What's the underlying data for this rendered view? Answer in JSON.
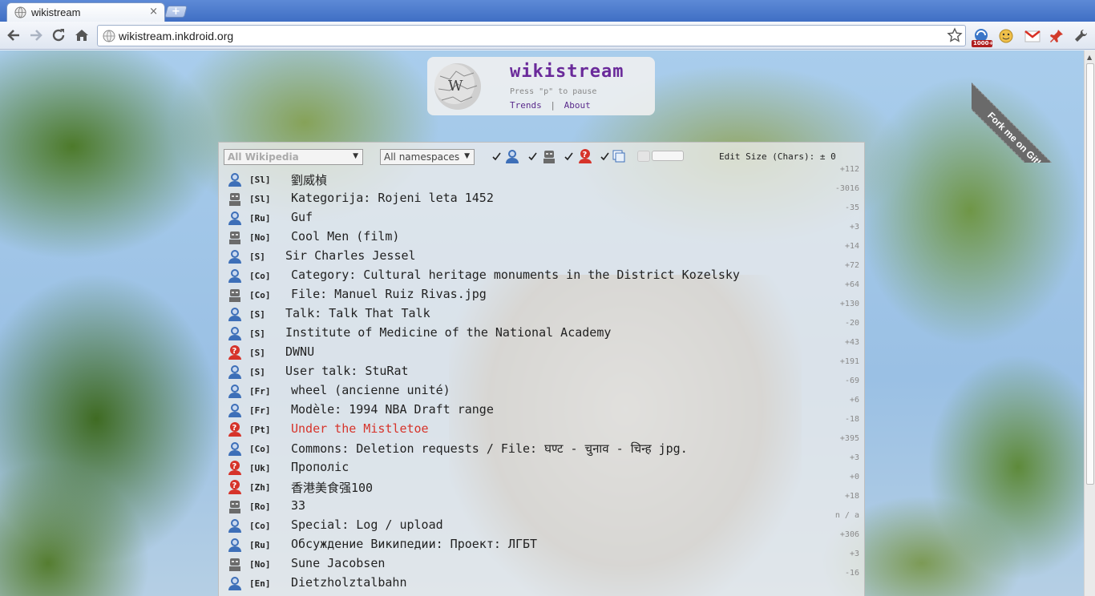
{
  "browser": {
    "tab_title": "wikistream",
    "tab_close": "×",
    "new_tab": "+",
    "url": "wikistream.inkdroid.org",
    "extension_badge": "1000+"
  },
  "header": {
    "title": "wikistream",
    "hint": "Press \"p\" to pause",
    "link_trends": "Trends",
    "separator": "|",
    "link_about": "About"
  },
  "ribbon": {
    "label": "Fork me on GitHub"
  },
  "filters": {
    "wiki_select": "All Wikipedia",
    "namespace_select": "All namespaces",
    "edit_size_label": "Edit Size (Chars): ± 0",
    "checkboxes": [
      {
        "name": "registered-users",
        "checked": true
      },
      {
        "name": "bots",
        "checked": true
      },
      {
        "name": "anonymous",
        "checked": true
      },
      {
        "name": "robots-filter",
        "checked": true
      }
    ]
  },
  "colors": {
    "registered": "#3d6fb8",
    "bot": "#6b6b6b",
    "anon": "#d6332a",
    "title_purple": "#6a2a9a"
  },
  "edits": [
    {
      "type": "user",
      "lang": "[Sl]",
      "title": "劉威楨",
      "delta": "+112",
      "partial": true
    },
    {
      "type": "bot",
      "lang": "[Sl]",
      "title": "Kategorija: Rojeni leta 1452",
      "delta": "-3016"
    },
    {
      "type": "user",
      "lang": "[Ru]",
      "title": "Guf",
      "delta": "-35"
    },
    {
      "type": "bot",
      "lang": "[No]",
      "title": "Cool Men (film)",
      "delta": "+3"
    },
    {
      "type": "user",
      "lang": "[S]",
      "title": "Sir Charles Jessel",
      "delta": "+14"
    },
    {
      "type": "user",
      "lang": "[Co]",
      "title": "Category: Cultural heritage monuments in the District Kozelsky",
      "delta": "+72"
    },
    {
      "type": "bot",
      "lang": "[Co]",
      "title": "File: Manuel Ruiz Rivas.jpg",
      "delta": "+64"
    },
    {
      "type": "user",
      "lang": "[S]",
      "title": "Talk: Talk That Talk",
      "delta": "+130"
    },
    {
      "type": "user",
      "lang": "[S]",
      "title": "Institute of Medicine of the National Academy",
      "delta": "-20"
    },
    {
      "type": "anon",
      "lang": "[S]",
      "title": "DWNU",
      "delta": "+43"
    },
    {
      "type": "user",
      "lang": "[S]",
      "title": "User talk: StuRat",
      "delta": "+191"
    },
    {
      "type": "user",
      "lang": "[Fr]",
      "title": "wheel (ancienne unité)",
      "delta": "-69"
    },
    {
      "type": "user",
      "lang": "[Fr]",
      "title": "Modèle: 1994 NBA Draft range",
      "delta": "+6"
    },
    {
      "type": "anon",
      "lang": "[Pt]",
      "title": "Under the Mistletoe",
      "delta": "-18",
      "red": true
    },
    {
      "type": "user",
      "lang": "[Co]",
      "title": "Commons: Deletion requests / File: घण्ट - चुनाव - चिन्ह jpg.",
      "delta": "+395"
    },
    {
      "type": "anon",
      "lang": "[Uk]",
      "title": "Прополіс",
      "delta": "+3"
    },
    {
      "type": "anon",
      "lang": "[Zh]",
      "title": "香港美食强100",
      "delta": "+0"
    },
    {
      "type": "bot",
      "lang": "[Ro]",
      "title": "33",
      "delta": "+18"
    },
    {
      "type": "user",
      "lang": "[Co]",
      "title": "Special: Log / upload",
      "delta": "n / a"
    },
    {
      "type": "user",
      "lang": "[Ru]",
      "title": "Обсуждение Википедии: Проект: ЛГБТ",
      "delta": "+306"
    },
    {
      "type": "bot",
      "lang": "[No]",
      "title": "Sune Jacobsen",
      "delta": "+3"
    },
    {
      "type": "user",
      "lang": "[En]",
      "title": "Dietzholztalbahn",
      "delta": "-16"
    }
  ]
}
